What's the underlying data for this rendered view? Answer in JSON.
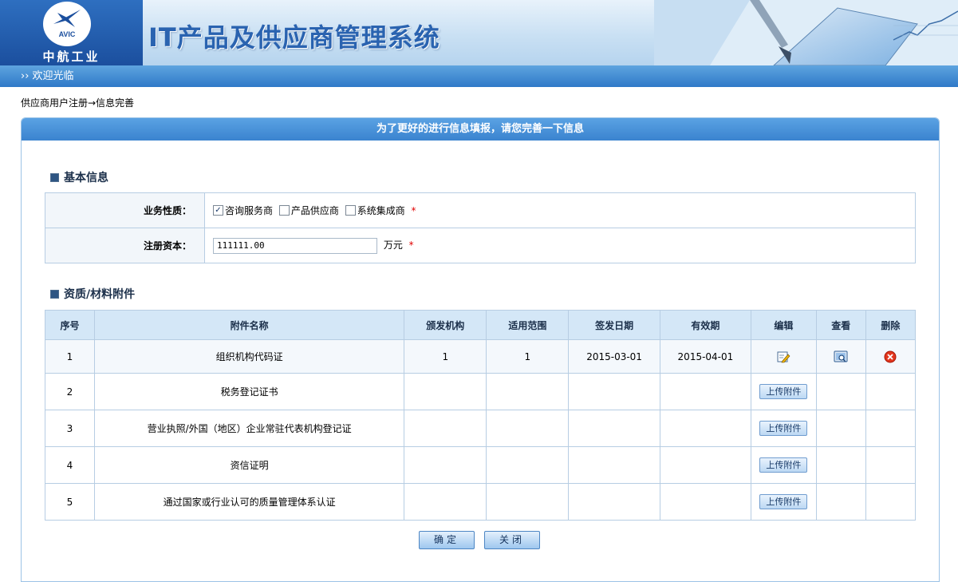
{
  "header": {
    "logo_text": "AVIC",
    "logo_name": "中航工业",
    "system_title": "IT产品及供应商管理系统"
  },
  "welcome": "›› 欢迎光临",
  "breadcrumb": "供应商用户注册→信息完善",
  "panel_title": "为了更好的进行信息填报，请您完善一下信息",
  "basic": {
    "title": "基本信息",
    "business_label": "业务性质：",
    "business_options": [
      {
        "label": "咨询服务商",
        "checked": true
      },
      {
        "label": "产品供应商",
        "checked": false
      },
      {
        "label": "系统集成商",
        "checked": false
      }
    ],
    "capital_label": "注册资本：",
    "capital_value": "111111.00",
    "capital_unit": "万元",
    "required_mark": "*"
  },
  "attachments": {
    "title": "资质/材料附件",
    "columns": [
      "序号",
      "附件名称",
      "颁发机构",
      "适用范围",
      "签发日期",
      "有效期",
      "编辑",
      "查看",
      "删除"
    ],
    "rows": [
      {
        "no": "1",
        "name": "组织机构代码证",
        "issuer": "1",
        "scope": "1",
        "issue_date": "2015-03-01",
        "valid_until": "2015-04-01"
      },
      {
        "no": "2",
        "name": "税务登记证书",
        "upload_label": "上传附件"
      },
      {
        "no": "3",
        "name": "营业执照/外国（地区）企业常驻代表机构登记证",
        "upload_label": "上传附件"
      },
      {
        "no": "4",
        "name": "资信证明",
        "upload_label": "上传附件"
      },
      {
        "no": "5",
        "name": "通过国家或行业认可的质量管理体系认证",
        "upload_label": "上传附件"
      }
    ]
  },
  "buttons": {
    "confirm": "确定",
    "close": "关闭"
  },
  "icons": {
    "edit": "edit-icon",
    "view": "view-icon",
    "delete": "delete-icon"
  },
  "colors": {
    "brand_blue": "#2a63b0",
    "bar_blue": "#3a83cf",
    "required": "#e00000",
    "header_cell": "#d4e7f7"
  }
}
